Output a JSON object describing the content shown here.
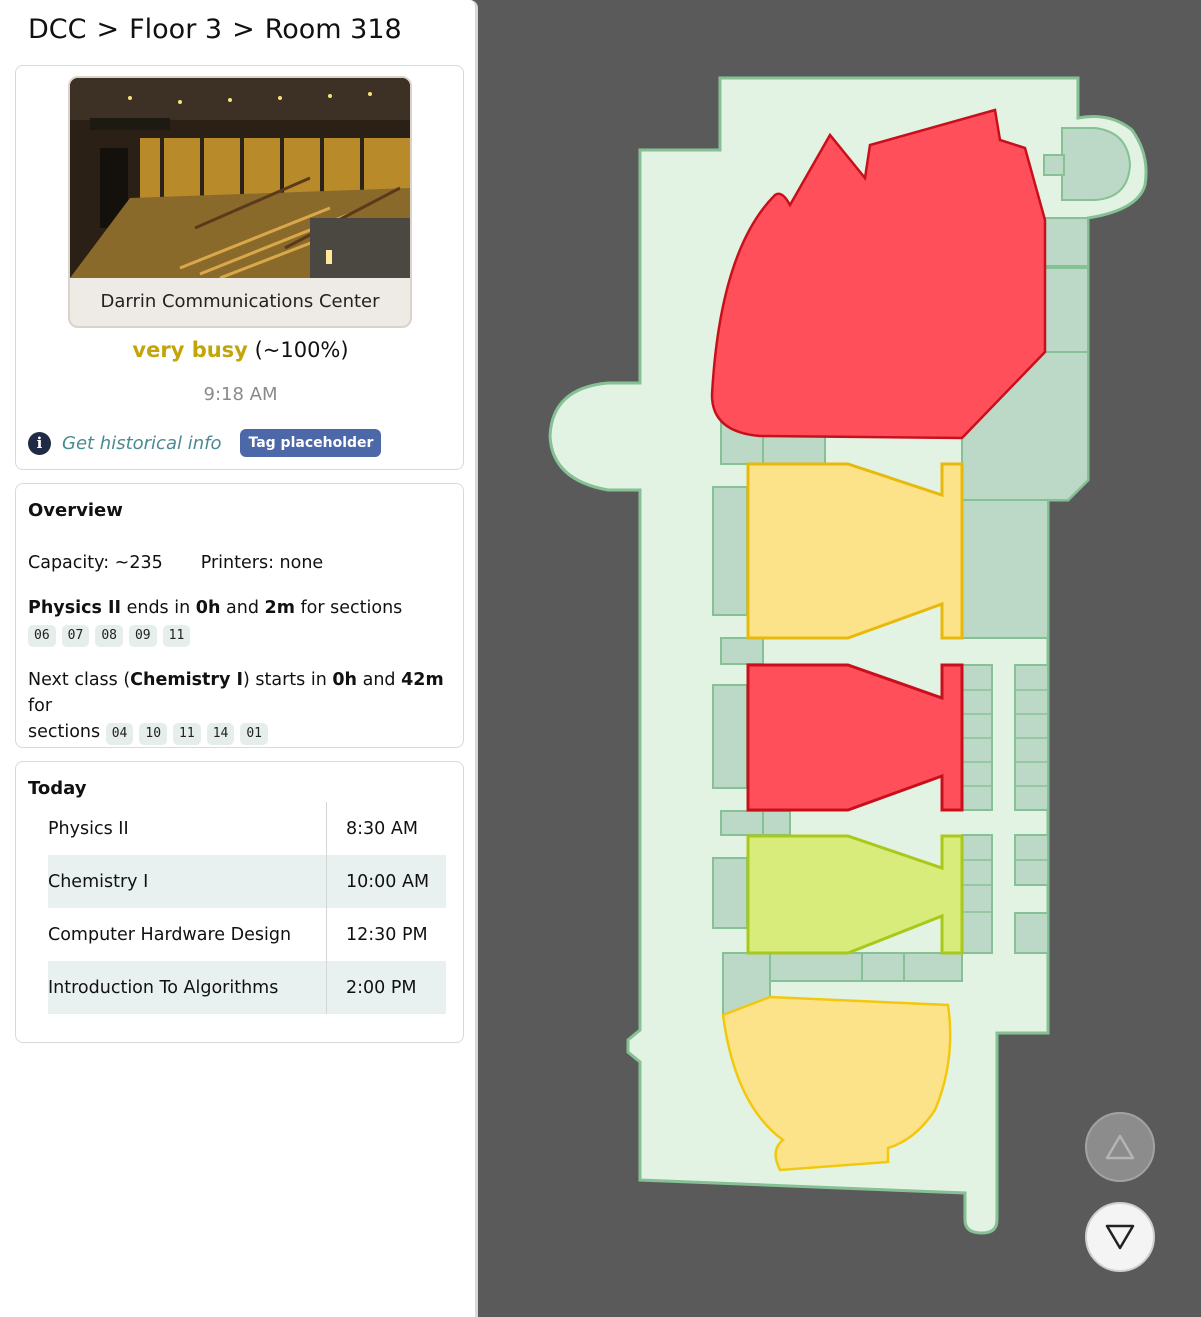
{
  "breadcrumb": {
    "building": "DCC",
    "floor": "Floor 3",
    "room": "Room 318",
    "separator": ">"
  },
  "building_card": {
    "photo_caption": "Darrin Communications Center",
    "busy_level": "very busy",
    "busy_percent": "(~100%)",
    "time": "9:18 AM",
    "historical_link": "Get historical info",
    "tag": "Tag placeholder"
  },
  "overview": {
    "title": "Overview",
    "capacity": "Capacity: ~235",
    "printers": "Printers: none",
    "current_class": {
      "name": "Physics II",
      "ends_in_text": "ends in",
      "hours": "0h",
      "and": "and",
      "minutes": "2m",
      "for_sections": "for sections",
      "sections": [
        "06",
        "07",
        "08",
        "09",
        "11"
      ]
    },
    "next_class": {
      "prefix": "Next class (",
      "name": "Chemistry I",
      "starts_in_text": ") starts in",
      "hours": "0h",
      "and": "and",
      "minutes": "42m",
      "for_text": "for",
      "sections_text": "sections",
      "sections": [
        "04",
        "10",
        "11",
        "14",
        "01"
      ]
    }
  },
  "today": {
    "title": "Today",
    "rows": [
      {
        "course": "Physics II",
        "time": "8:30 AM"
      },
      {
        "course": "Chemistry I",
        "time": "10:00 AM"
      },
      {
        "course": "Computer Hardware Design",
        "time": "12:30 PM"
      },
      {
        "course": "Introduction To Algorithms",
        "time": "2:00 PM"
      }
    ]
  },
  "map": {
    "colors": {
      "busy": "#ff4f5a",
      "moderate": "#fce38a",
      "light": "#d7ec7a",
      "floor": "#e3f3e3",
      "room": "#bcd8c6"
    }
  },
  "nav": {
    "up_icon": "triangle-up-icon",
    "down_icon": "triangle-down-icon"
  }
}
